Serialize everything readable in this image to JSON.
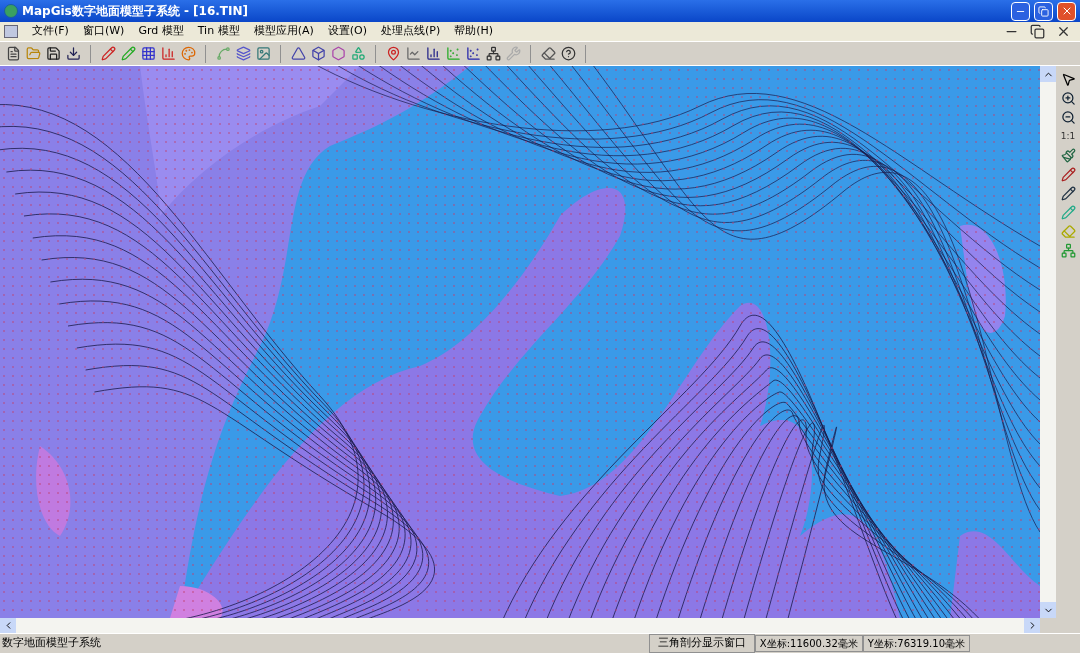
{
  "window": {
    "title": "MapGis数字地面模型子系统 - [16.TIN]"
  },
  "menu": [
    "文件(F)",
    "窗口(W)",
    "Grd 模型",
    "Tin 模型",
    "模型应用(A)",
    "设置(O)",
    "处理点线(P)",
    "帮助(H)"
  ],
  "side_tools": {
    "scale_label": "1:1"
  },
  "status_bar": {
    "app_name": "数字地面模型子系统",
    "window_name": "三角剖分显示窗口",
    "x_coord": "X坐标:11600.32毫米",
    "y_coord": "Y坐标:76319.10毫米"
  }
}
